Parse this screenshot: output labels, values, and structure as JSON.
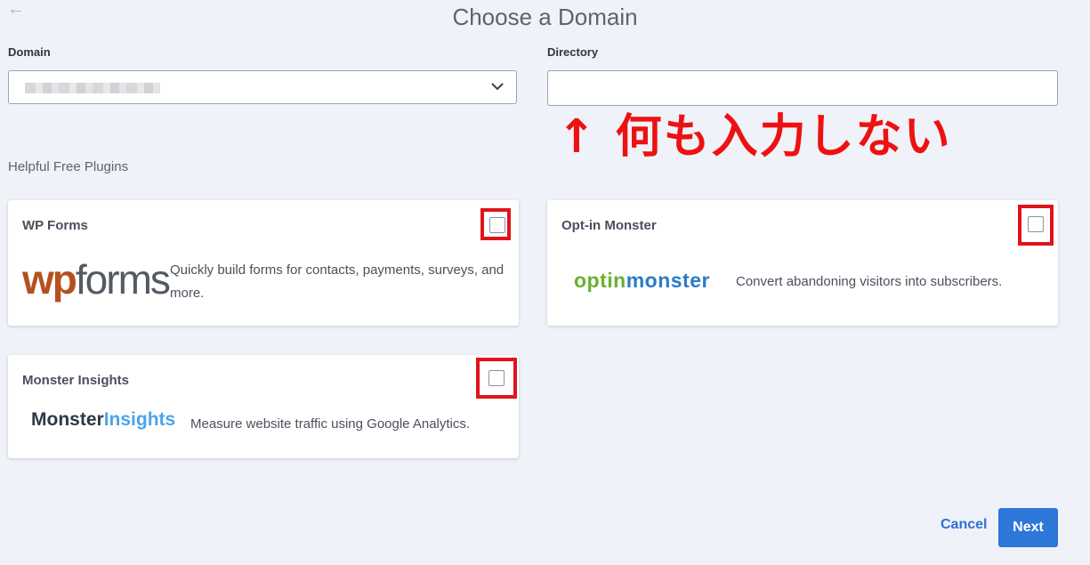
{
  "header": {
    "back_icon": "arrow-left-icon",
    "title": "Choose a Domain"
  },
  "form": {
    "domain_label": "Domain",
    "domain_value": "",
    "directory_label": "Directory",
    "directory_value": "",
    "directory_placeholder": ""
  },
  "annotation": {
    "text": "↑ 何も入力しない",
    "color": "#ee1111"
  },
  "plugins": {
    "section_label": "Helpful Free Plugins",
    "items": [
      {
        "title": "WP Forms",
        "logo_part1": "wp",
        "logo_part2": "forms",
        "description": "Quickly build forms for contacts, payments, surveys, and more.",
        "checked": false
      },
      {
        "title": "Opt-in Monster",
        "logo_part1": "optin",
        "logo_part2": "monster",
        "description": "Convert abandoning visitors into subscribers.",
        "checked": false
      },
      {
        "title": "Monster Insights",
        "logo_part1": "Monster",
        "logo_part2": "Insights",
        "description": "Measure website traffic using Google Analytics.",
        "checked": false
      }
    ]
  },
  "footer": {
    "cancel_label": "Cancel",
    "next_label": "Next"
  },
  "colors": {
    "accent": "#2c77d8",
    "highlight": "#e0141b",
    "background": "#eff2f8"
  }
}
